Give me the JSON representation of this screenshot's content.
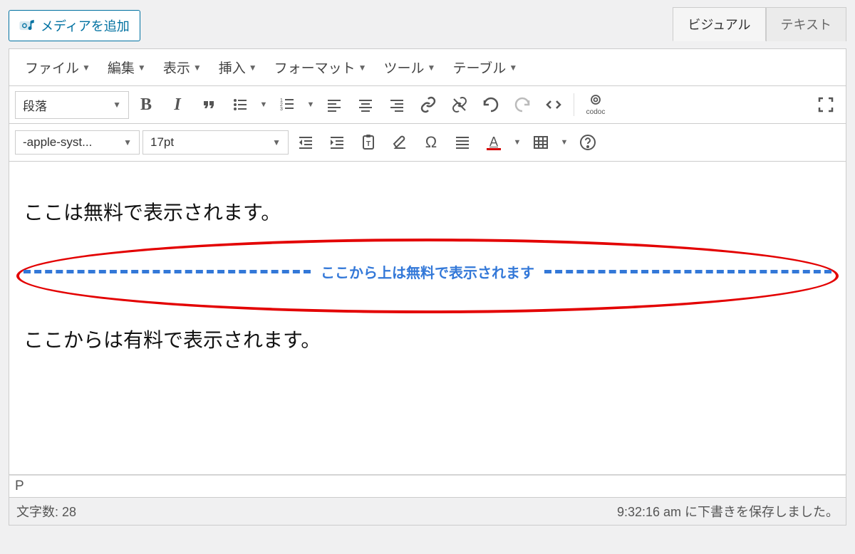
{
  "media_button": "メディアを追加",
  "tabs": {
    "visual": "ビジュアル",
    "text": "テキスト"
  },
  "menu": {
    "file": "ファイル",
    "edit": "編集",
    "view": "表示",
    "insert": "挿入",
    "format": "フォーマット",
    "tools": "ツール",
    "table": "テーブル"
  },
  "toolbar": {
    "paragraph_select": "段落",
    "font_family_select": "-apple-syst...",
    "font_size_select": "17pt",
    "codoc_label": "codoc"
  },
  "content": {
    "free_text": "ここは無料で表示されます。",
    "divider_label": "ここから上は無料で表示されます",
    "paid_text": "ここからは有料で表示されます。"
  },
  "status": {
    "path": "P",
    "word_count_label": "文字数: ",
    "word_count_value": "28",
    "save_message": "9:32:16 am に下書きを保存しました。"
  }
}
